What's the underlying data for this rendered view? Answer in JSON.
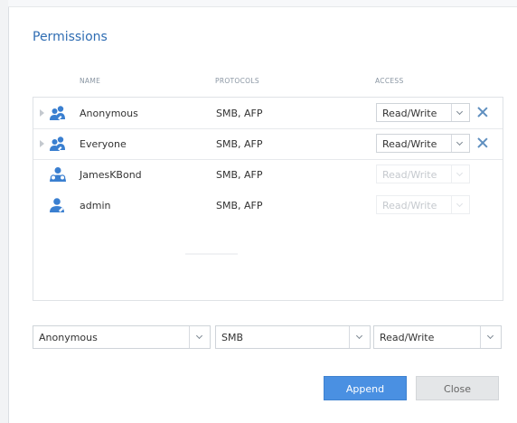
{
  "dialog": {
    "title": "Permissions"
  },
  "table": {
    "headers": {
      "name": "NAME",
      "protocols": "PROTOCOLS",
      "access": "ACCESS"
    },
    "rows": [
      {
        "name": "Anonymous",
        "protocols": "SMB, AFP",
        "access": "Read/Write",
        "icon": "group-icon",
        "expandable": true,
        "editable": true,
        "removable": true
      },
      {
        "name": "Everyone",
        "protocols": "SMB, AFP",
        "access": "Read/Write",
        "icon": "group-icon",
        "expandable": true,
        "editable": true,
        "removable": true
      },
      {
        "name": "JamesKBond",
        "protocols": "SMB, AFP",
        "access": "Read/Write",
        "icon": "user-group-icon",
        "expandable": false,
        "editable": false,
        "removable": false
      },
      {
        "name": "admin",
        "protocols": "SMB, AFP",
        "access": "Read/Write",
        "icon": "user-icon",
        "expandable": false,
        "editable": false,
        "removable": false
      }
    ]
  },
  "add_row": {
    "user": "Anonymous",
    "protocol": "SMB",
    "access": "Read/Write"
  },
  "buttons": {
    "append": "Append",
    "close": "Close"
  },
  "colors": {
    "title": "#2f6db3",
    "accent": "#4a90e2",
    "icon": "#3a7fd0"
  }
}
